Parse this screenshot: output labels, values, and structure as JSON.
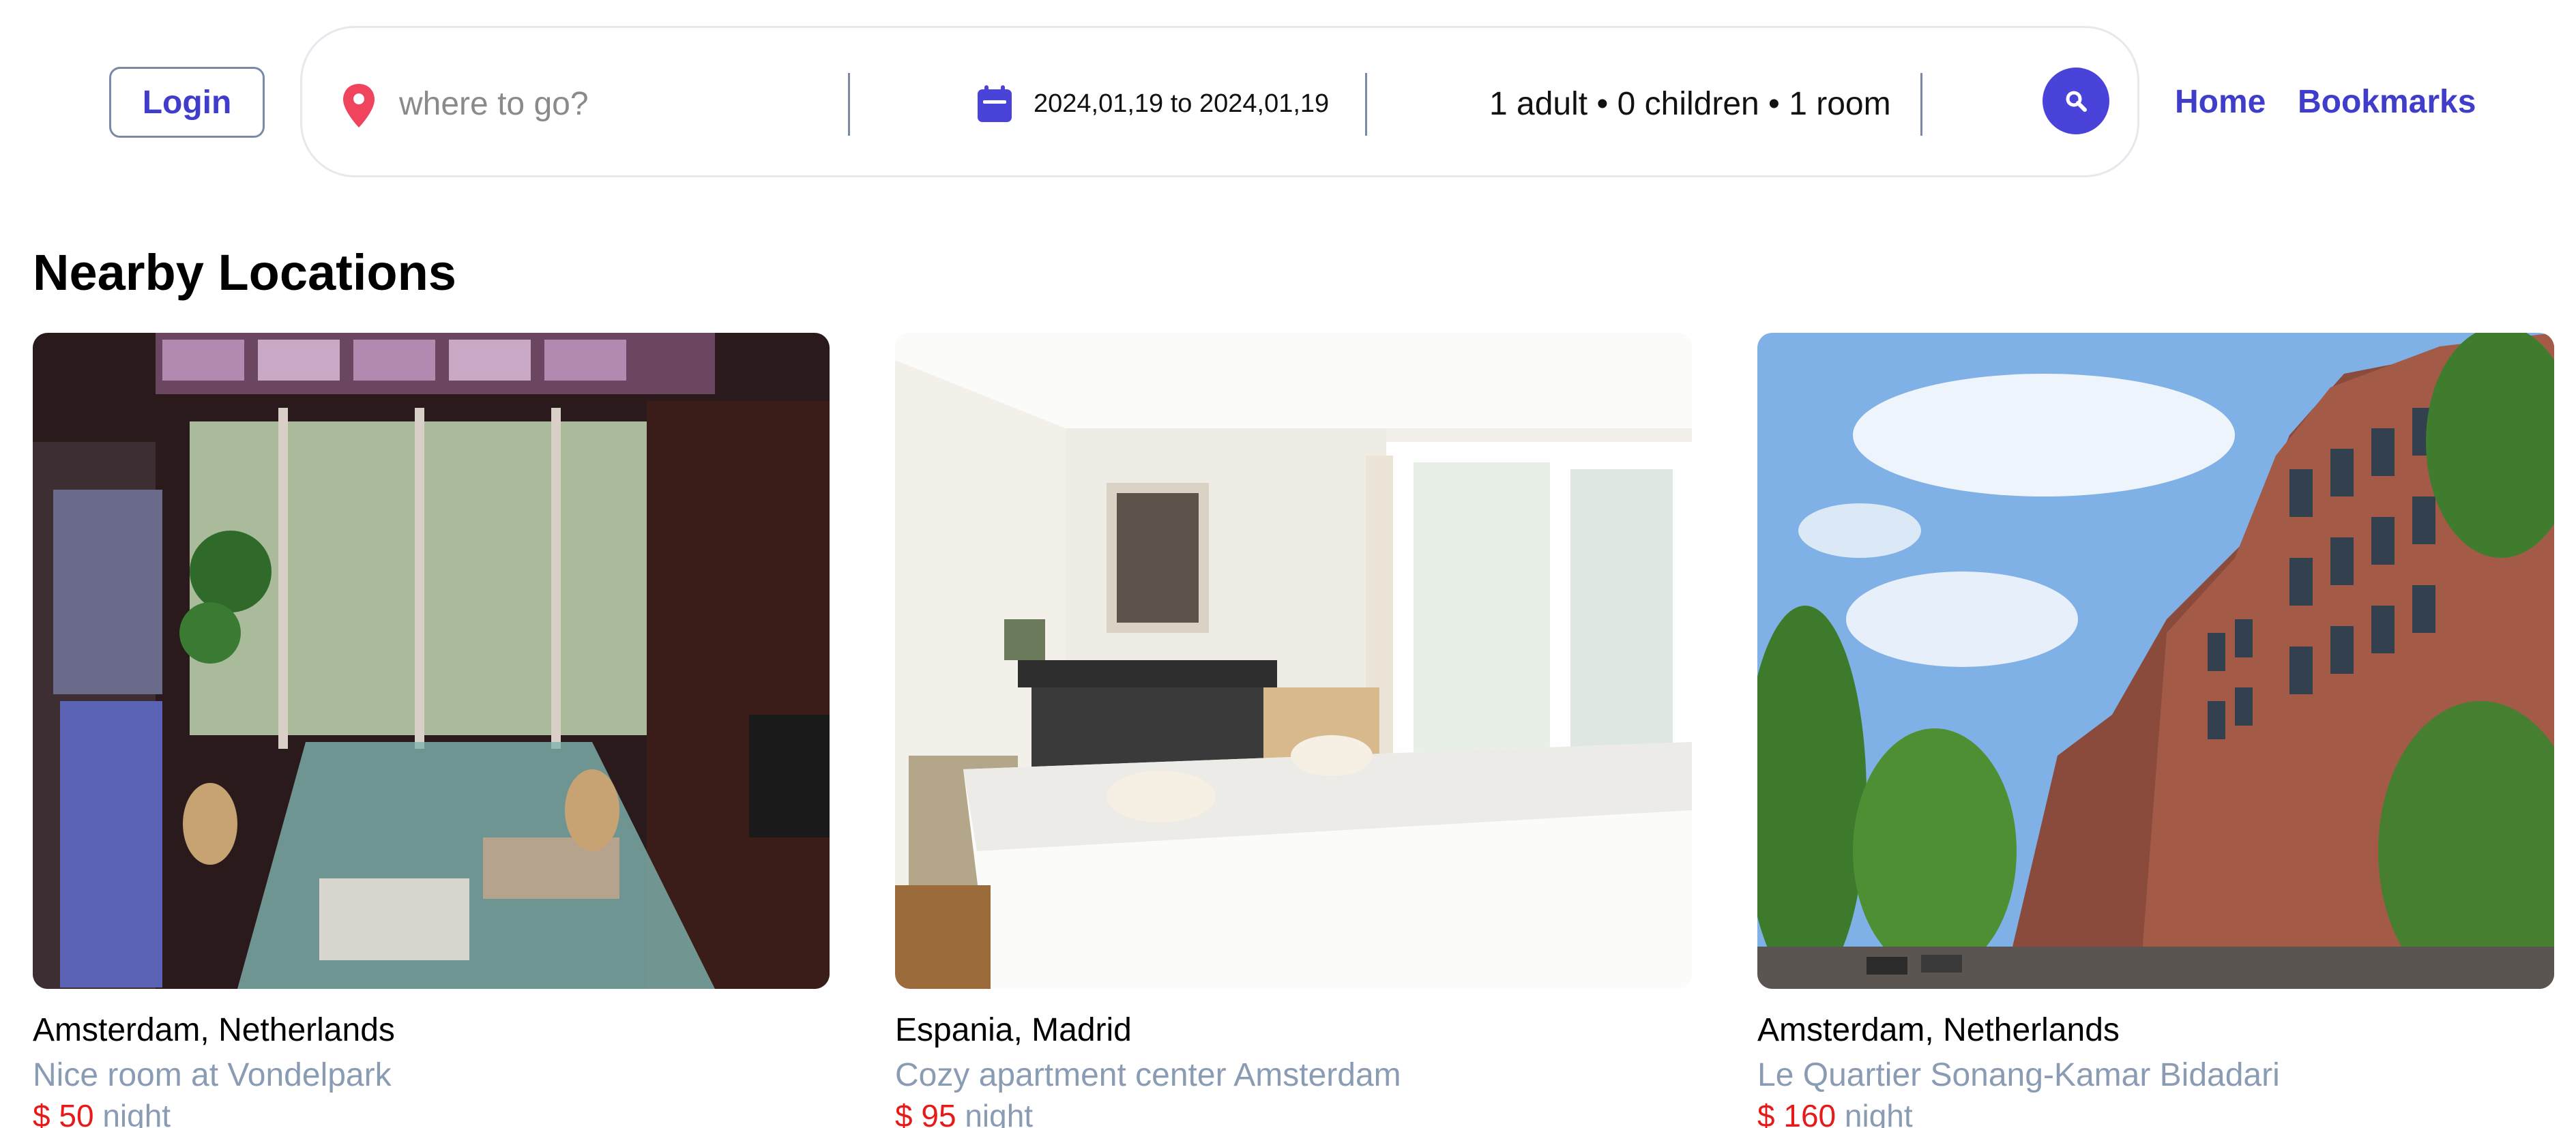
{
  "header": {
    "login_label": "Login",
    "search": {
      "location_placeholder": "where to go?",
      "date_range": "2024,01,19 to 2024,01,19",
      "guests": "1 adult • 0 children • 1 room"
    },
    "nav": {
      "home": "Home",
      "bookmarks": "Bookmarks"
    }
  },
  "section": {
    "title": "Nearby Locations"
  },
  "cards": [
    {
      "location": "Amsterdam, Netherlands",
      "name": "Nice room at Vondelpark",
      "price": "$ 50",
      "unit": "night"
    },
    {
      "location": "Espania, Madrid",
      "name": "Cozy apartment center Amsterdam",
      "price": "$ 95",
      "unit": "night"
    },
    {
      "location": "Amsterdam, Netherlands",
      "name": "Le Quartier Sonang-Kamar Bidadari",
      "price": "$ 160",
      "unit": "night"
    }
  ],
  "colors": {
    "accent": "#4a43d9",
    "pin": "#f0435e",
    "price": "#e81919",
    "muted": "#8a9bb4"
  }
}
